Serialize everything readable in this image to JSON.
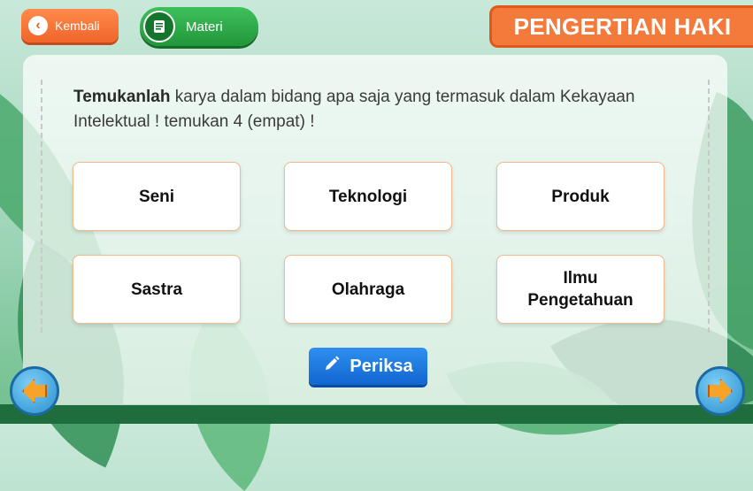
{
  "header": {
    "back_label": "Kembali",
    "back_icon": "chevron-left-icon",
    "materi_label": "Materi",
    "materi_icon": "book-icon",
    "title": "PENGERTIAN HAKI"
  },
  "question": {
    "bold": "Temukanlah",
    "text": " karya dalam bidang apa saja yang termasuk dalam Kekayaan Intelektual ! temukan 4 (empat) !"
  },
  "options": [
    {
      "label": "Seni"
    },
    {
      "label": "Teknologi"
    },
    {
      "label": "Produk"
    },
    {
      "label": "Sastra"
    },
    {
      "label": "Olahraga"
    },
    {
      "label": "Ilmu Pengetahuan"
    }
  ],
  "actions": {
    "check_label": "Periksa",
    "check_icon": "pencil-icon",
    "prev_icon": "arrow-left-icon",
    "next_icon": "arrow-right-icon"
  },
  "colors": {
    "accent_orange": "#f47a3c",
    "materi_green": "#21963a",
    "check_blue": "#1266d0",
    "option_border": "#f0b98e"
  }
}
